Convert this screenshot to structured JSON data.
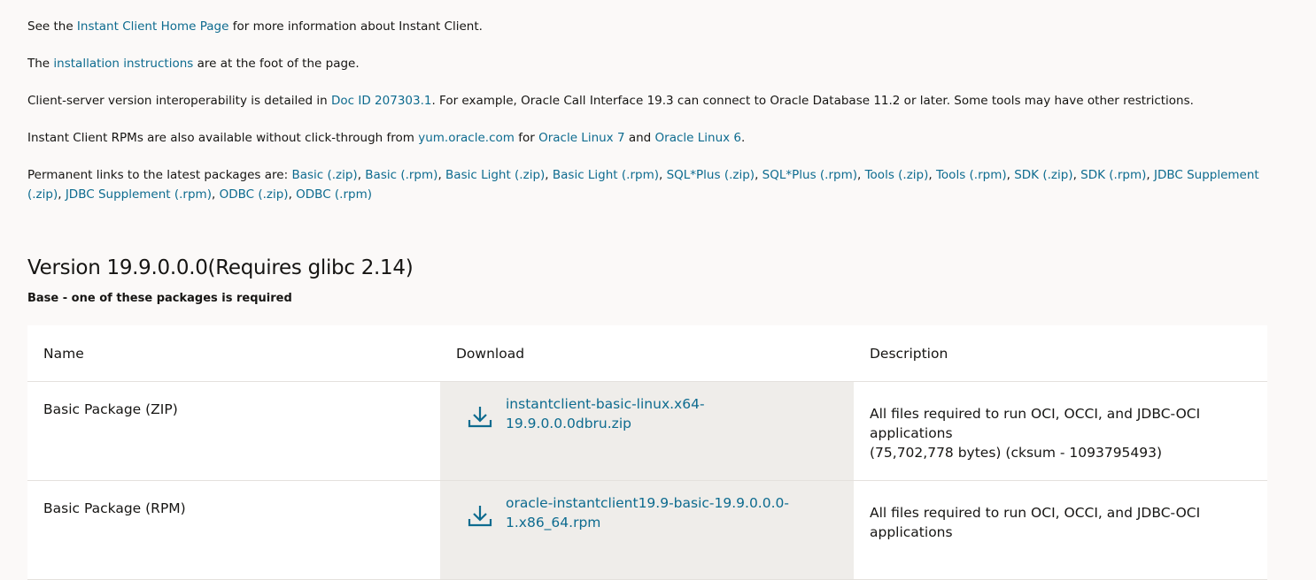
{
  "intro": {
    "line1": {
      "before": "See the ",
      "link": "Instant Client Home Page",
      "after": " for more information about Instant Client."
    },
    "line2": {
      "before": "The ",
      "link": "installation instructions",
      "after": " are at the foot of the page."
    },
    "line3": {
      "before": "Client-server version interoperability is detailed in ",
      "link": "Doc ID 207303.1",
      "after": ". For example, Oracle Call Interface 19.3 can connect to Oracle Database 11.2 or later. Some tools may have other restrictions."
    },
    "line4": {
      "before": "Instant Client RPMs are also available without click-through from ",
      "link1": "yum.oracle.com",
      "mid1": " for ",
      "link2": "Oracle Linux 7",
      "mid2": " and ",
      "link3": "Oracle Linux 6",
      "after": "."
    },
    "line5": {
      "before": "Permanent links to the latest packages are: ",
      "links": [
        "Basic (.zip)",
        "Basic (.rpm)",
        "Basic Light (.zip)",
        "Basic Light (.rpm)",
        "SQL*Plus (.zip)",
        "SQL*Plus (.rpm)",
        "Tools (.zip)",
        "Tools (.rpm)",
        "SDK (.zip)",
        "SDK (.rpm)",
        "JDBC Supplement (.zip)",
        "JDBC Supplement (.rpm)",
        "ODBC (.zip)",
        "ODBC (.rpm)"
      ]
    }
  },
  "version_heading": "Version 19.9.0.0.0(Requires glibc 2.14)",
  "subheading": "Base - one of these packages is required",
  "table": {
    "headers": [
      "Name",
      "Download",
      "Description"
    ],
    "rows": [
      {
        "name": "Basic Package (ZIP)",
        "download_line1": "instantclient-basic-linux.x64-",
        "download_line2": "19.9.0.0.0dbru.zip",
        "desc_line1": "All files required to run OCI, OCCI, and JDBC-OCI",
        "desc_line2": "applications",
        "desc_line3": "(75,702,778 bytes) (cksum - 1093795493)"
      },
      {
        "name": "Basic Package (RPM)",
        "download_line1": "oracle-instantclient19.9-basic-19.9.0.0.0-",
        "download_line2": "1.x86_64.rpm",
        "desc_line1": "All files required to run OCI, OCCI, and JDBC-OCI",
        "desc_line2": "applications"
      }
    ]
  },
  "colors": {
    "link": "#0d6b8f",
    "background": "#fbf9f8",
    "download_cell": "#efedea"
  },
  "icons": {
    "download": "download-icon"
  }
}
